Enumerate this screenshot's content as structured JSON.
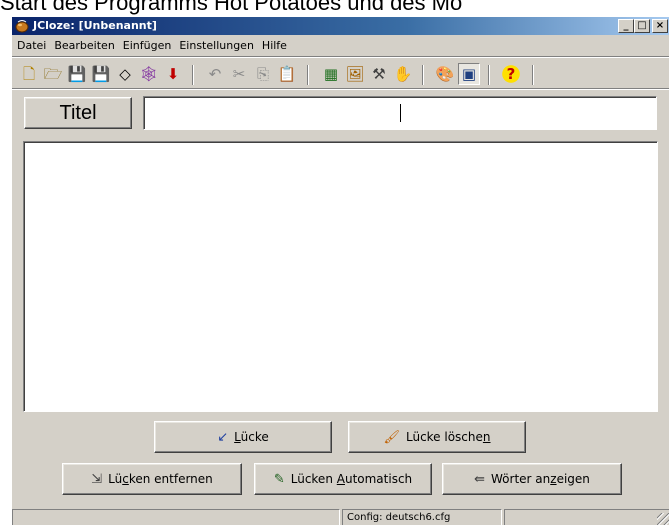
{
  "caption": {
    "text": "Start des Programms Hot Potatoes und des Mo"
  },
  "window": {
    "title": "JCloze: [Unbenannt]",
    "controls": {
      "minimize": "_",
      "maximize": "□",
      "close": "×"
    }
  },
  "menu": {
    "items": [
      "Datei",
      "Bearbeiten",
      "Einfügen",
      "Einstellungen",
      "Hilfe"
    ]
  },
  "toolbar": {
    "icons": [
      "new-file-icon",
      "open-folder-icon",
      "save-icon",
      "save-as-icon",
      "eraser-icon",
      "web-export-icon",
      "arrow-down-icon",
      "undo-icon",
      "cut-icon",
      "copy-icon",
      "paste-icon",
      "gap-config-icon",
      "image-icon",
      "tool-icon",
      "help-book-icon",
      "palette-icon",
      "layout-icon",
      "help-icon"
    ],
    "glyphs": {
      "new": "🗋",
      "open": "🗁",
      "save": "💾",
      "save_as": "💾",
      "eraser": "◇",
      "web": "🕸",
      "arrow": "⬇",
      "undo": "↶",
      "cut": "✂",
      "copy": "⎘",
      "paste": "📋",
      "config": "▦",
      "image": "🖼",
      "tool": "⚒",
      "hands": "✋",
      "palette": "🎨",
      "layout": "▣",
      "help": "?"
    }
  },
  "title_row": {
    "label": "Titel",
    "value": "",
    "placeholder": ""
  },
  "editor": {
    "content": ""
  },
  "buttons": {
    "gap": {
      "icon_name": "gap-icon",
      "glyph": "↙",
      "pre": "",
      "ul": "L",
      "post": "ücke"
    },
    "delete_gap": {
      "icon_name": "brush-icon",
      "glyph": "🖌",
      "pre": "Lücke lösche",
      "ul": "n",
      "post": ""
    },
    "remove_gaps": {
      "icon_name": "remove-gaps-icon",
      "glyph": "⇲",
      "pre": "Lü",
      "ul": "c",
      "post": "ken entfernen"
    },
    "auto_gaps": {
      "icon_name": "magic-wand-icon",
      "glyph": "✎",
      "pre": "Lücken ",
      "ul": "A",
      "post": "utomatisch"
    },
    "show_words": {
      "icon_name": "word-list-icon",
      "glyph": "⇚",
      "pre": "Wörter an",
      "ul": "z",
      "post": "eigen"
    }
  },
  "statusbar": {
    "pane1": "",
    "pane2": "Config: deutsch6.cfg",
    "pane3": ""
  },
  "colors": {
    "titlebar_start": "#0a246a",
    "titlebar_end": "#a6caf0",
    "face": "#d4d0c8"
  }
}
